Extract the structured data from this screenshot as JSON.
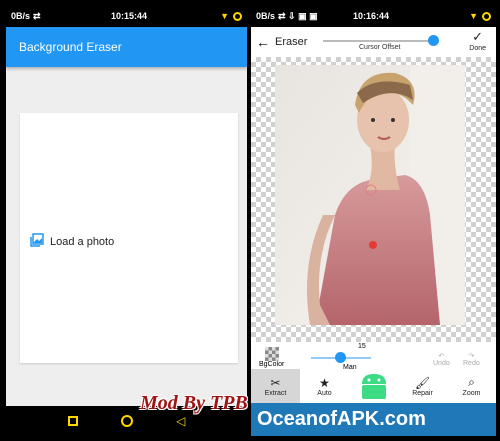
{
  "left_phone": {
    "status": {
      "net": "0B/s",
      "time": "10:15:44"
    },
    "appbar_title": "Background Eraser",
    "load_label": "Load a photo"
  },
  "right_phone": {
    "status": {
      "net": "0B/s",
      "time": "10:16:44"
    },
    "toolbar": {
      "title": "Eraser",
      "cursor_label": "Cursor Offset",
      "done_label": "Done",
      "cursor_offset": 0.9
    },
    "controls": {
      "bg_label": "BgColor",
      "brush_size": "15",
      "mode_label": "Man",
      "undo_label": "Undo",
      "redo_label": "Redo"
    },
    "tools": [
      {
        "label": "Extract",
        "icon": "scissors-icon",
        "active": true
      },
      {
        "label": "Auto",
        "icon": "star-icon",
        "active": false
      },
      {
        "label": "",
        "icon": "android-icon",
        "active": false
      },
      {
        "label": "Repair",
        "icon": "brush-icon",
        "active": false
      },
      {
        "label": "Zoom",
        "icon": "zoom-icon",
        "active": false
      }
    ]
  },
  "watermark": {
    "mod_by": "Mod By TPB",
    "brand": "OceanofAPK.com"
  },
  "colors": {
    "primary": "#2196f3",
    "banner": "#1f78b8",
    "accent": "#a01313"
  }
}
